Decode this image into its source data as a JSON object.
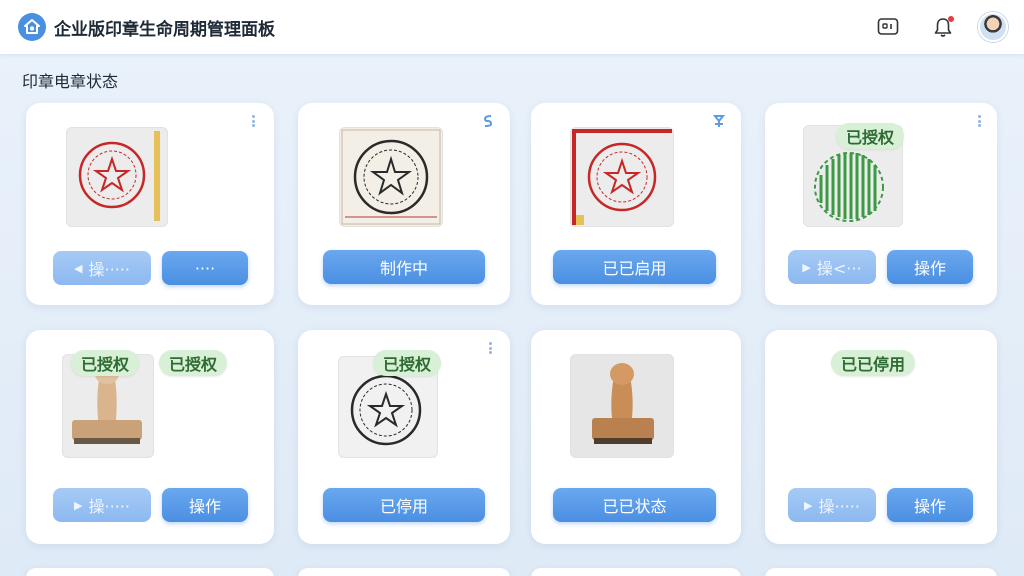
{
  "header": {
    "title": "企业版印章生命周期管理面板",
    "icons": {
      "logo": "home-shield-icon",
      "messages": "message-box-icon",
      "notifications": "bell-icon",
      "avatar": "user-avatar"
    },
    "colors": {
      "accent": "#4b8fe2",
      "badge_bg": "#d8f0d6",
      "badge_text": "#2f6b35",
      "notification_dot": "#e53e3e"
    }
  },
  "section": {
    "title": "印章电章状态"
  },
  "cards": [
    {
      "image": "red-circular-seal",
      "buttons": [
        "操·····",
        "····"
      ],
      "menu_icon": "kebab-icon"
    },
    {
      "image": "black-circular-seal",
      "buttons": [
        "制作中"
      ],
      "corner_icon": "link-icon"
    },
    {
      "image": "red-circular-seal-framed",
      "buttons": [
        "已已启用"
      ],
      "corner_icon": "pin-icon"
    },
    {
      "image": "green-striped-seal",
      "badge": "已授权",
      "buttons": [
        "操<···",
        "操作"
      ],
      "menu_icon": "kebab-icon"
    },
    {
      "image": "wooden-stamp",
      "badges": [
        "已授权",
        "已授权"
      ],
      "buttons": [
        "操·····",
        "操作"
      ]
    },
    {
      "image": "black-circular-seal",
      "badge": "已授权",
      "buttons": [
        "已停用"
      ],
      "menu_icon": "kebab-icon"
    },
    {
      "image": "wooden-stamp",
      "buttons": [
        "已已状态"
      ]
    },
    {
      "image": "",
      "badge": "已已停用",
      "buttons": [
        "操·····",
        "操作"
      ]
    }
  ]
}
